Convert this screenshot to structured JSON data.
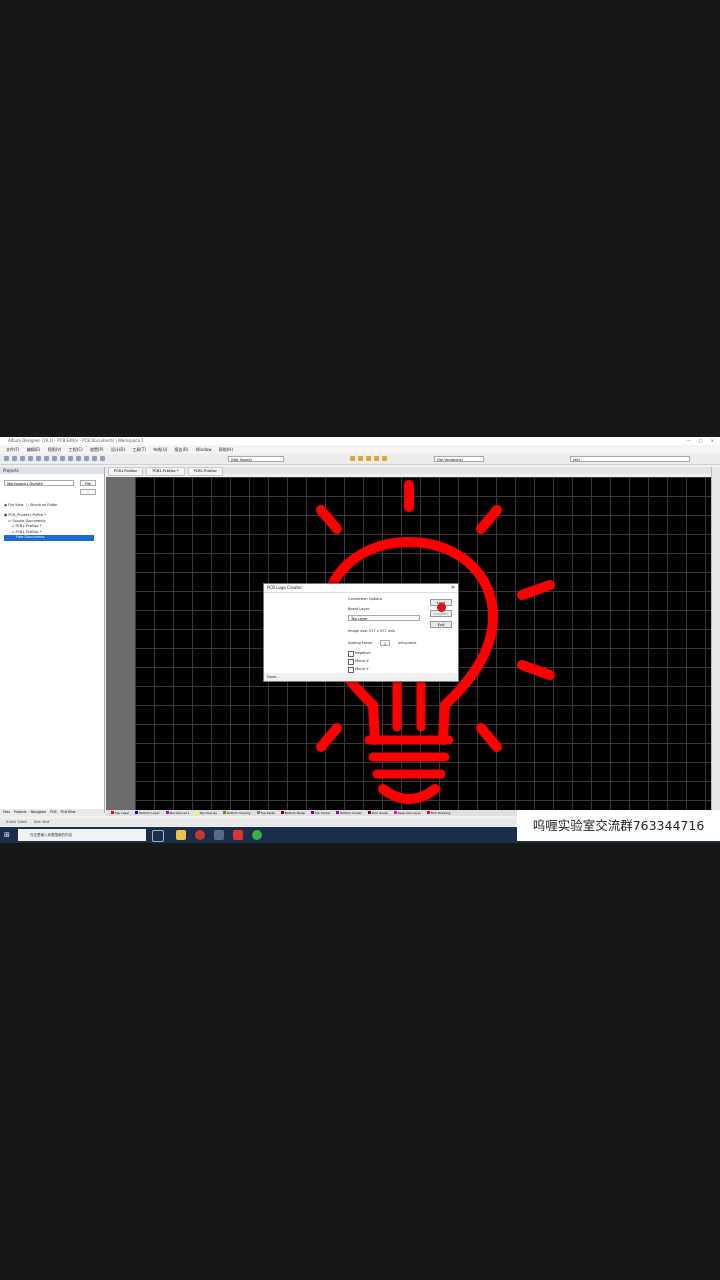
{
  "window": {
    "title": "Altium Designer (19.1) · PCB Editor · PCB Documents \\ Workspace 1"
  },
  "menu": [
    "文件(F)",
    "编辑(E)",
    "视图(V)",
    "工程(C)",
    "放置(P)",
    "设计(D)",
    "工具(T)",
    "布线(U)",
    "报告(R)",
    "Window",
    "帮助(H)"
  ],
  "toolbar": {
    "combo1": "(Not Saved)",
    "combo2": "(No Variations)",
    "search_placeholder": "(all)"
  },
  "projects_panel": {
    "title": "Projects",
    "workspace_combo": "Workspace1.DsnWrk",
    "btn_file": "File",
    "btn_folder": "",
    "radio1": "File View",
    "radio2": "Structure Editor",
    "tree": [
      "PCB_Project1.PrjPcb *",
      "Source Documents",
      "PCB1.PcbDoc *",
      "PCB1.PcbDoc *",
      "Free Documents"
    ],
    "bottom_tabs": [
      "Files",
      "Projects",
      "Navigator",
      "PCB",
      "PCB Filter"
    ]
  },
  "doc_tabs": [
    "PCB1.PcbDoc",
    "PCB1.PcbDoc *",
    "PCB1.PcbDoc"
  ],
  "layer_tabs": [
    {
      "label": "Top Layer",
      "color": "#ff0000"
    },
    {
      "label": "Bottom Layer",
      "color": "#0000ff"
    },
    {
      "label": "Mechanical 1",
      "color": "#c000c0"
    },
    {
      "label": "Top Overlay",
      "color": "#ffff00"
    },
    {
      "label": "Bottom Overlay",
      "color": "#808000"
    },
    {
      "label": "Top Paste",
      "color": "#808080"
    },
    {
      "label": "Bottom Paste",
      "color": "#800000"
    },
    {
      "label": "Top Solder",
      "color": "#800080"
    },
    {
      "label": "Bottom Solder",
      "color": "#a000a0"
    },
    {
      "label": "Drill Guide",
      "color": "#800000"
    },
    {
      "label": "Keep-Out Layer",
      "color": "#ff00ff"
    },
    {
      "label": "Drill Drawing",
      "color": "#ff002a"
    }
  ],
  "status_bar": [
    "X:0mil Y:0mil",
    "Grid: 5mil"
  ],
  "taskbar": {
    "search_placeholder": "在这里输入你要搜索的内容"
  },
  "dialog": {
    "title": "PCB Logo Creator",
    "section_label": "Conversion Options",
    "board_layer_label": "Board Layer",
    "board_layer_value": "Top Layer",
    "image_size_label": "Image size:",
    "image_size_value": "577 x 577 mils",
    "scaling_label": "Scaling Factor",
    "scaling_value": "1",
    "scaling_unit": "mils/pixels",
    "option_negative": "Negative",
    "option_mirror_x": "Mirror X",
    "option_mirror_y": "Mirror Y",
    "btn_load": "Load",
    "btn_convert": "Convert",
    "btn_exit": "Exit",
    "footer": "Done..."
  },
  "watermark": "呜喱实验室交流群763344716",
  "colors": {
    "bulb": "#ff0000",
    "canvas": "#000000",
    "grid": "#3a3a3a"
  }
}
